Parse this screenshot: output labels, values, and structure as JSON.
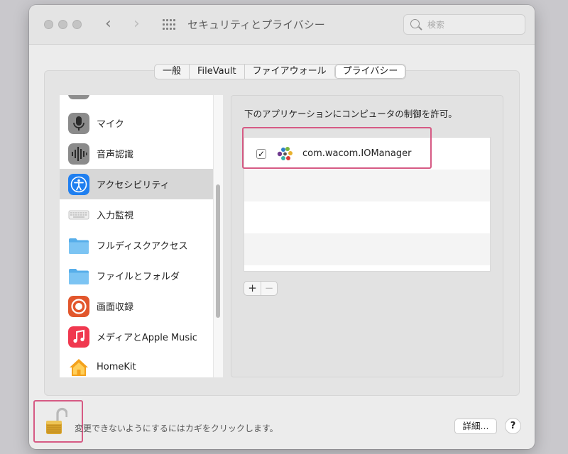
{
  "window": {
    "title": "セキュリティとプライバシー"
  },
  "search": {
    "placeholder": "検索"
  },
  "tabs": [
    {
      "label": "一般"
    },
    {
      "label": "FileVault"
    },
    {
      "label": "ファイアウォール"
    },
    {
      "label": "プライバシー"
    }
  ],
  "sidebar": {
    "items": [
      {
        "label": "マイク",
        "icon": "microphone-icon"
      },
      {
        "label": "音声認識",
        "icon": "speech-recognition-icon"
      },
      {
        "label": "アクセシビリティ",
        "icon": "accessibility-icon"
      },
      {
        "label": "入力監視",
        "icon": "keyboard-icon"
      },
      {
        "label": "フルディスクアクセス",
        "icon": "folder-icon"
      },
      {
        "label": "ファイルとフォルダ",
        "icon": "folder-icon"
      },
      {
        "label": "画面収録",
        "icon": "screen-recording-icon"
      },
      {
        "label": "メディアとApple Music",
        "icon": "music-icon"
      },
      {
        "label": "HomeKit",
        "icon": "home-icon"
      }
    ],
    "selected": "アクセシビリティ"
  },
  "panel": {
    "description": "下のアプリケーションにコンピュータの制御を許可。",
    "apps": [
      {
        "name": "com.wacom.IOManager",
        "checked": true,
        "check_mark": "✓"
      }
    ],
    "add_label": "+",
    "remove_label": "−"
  },
  "footer": {
    "lock_text": "変更できないようにするにはカギをクリックします。",
    "details_label": "詳細...",
    "help_label": "?"
  },
  "colors": {
    "highlight": "#d65a84",
    "selected_row": "#d7d7d7",
    "accessibility_blue": "#1f7ff0"
  }
}
